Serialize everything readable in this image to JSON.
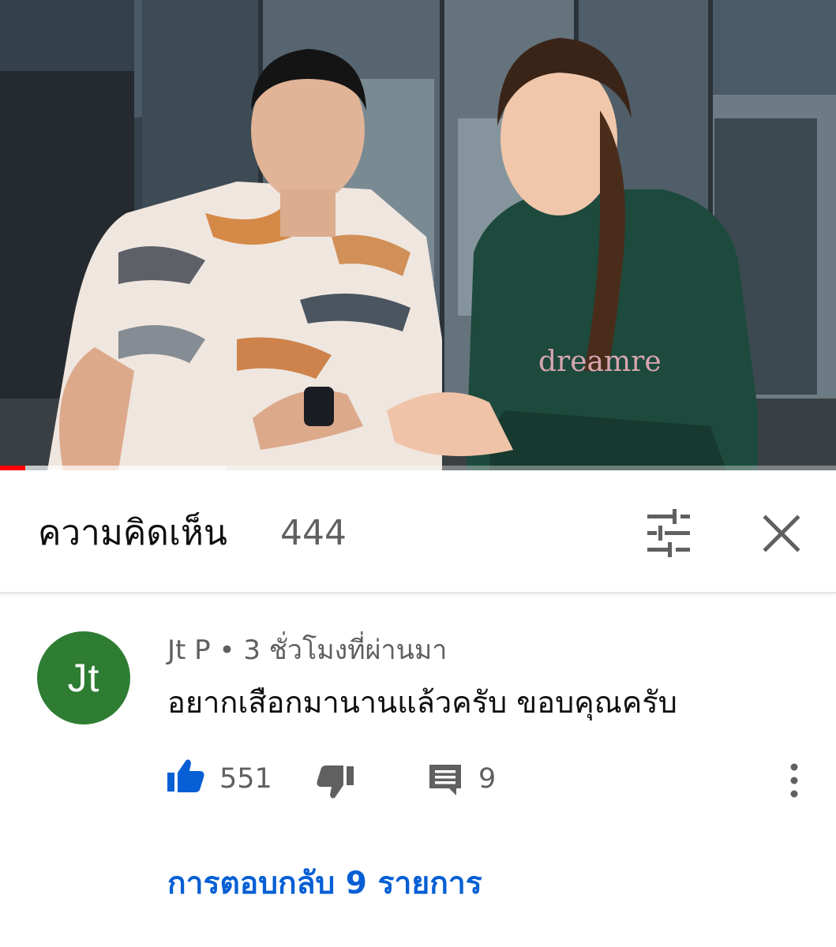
{
  "video": {
    "progress_fraction": 0.03,
    "buffered_fraction": 0.27,
    "shirt_print_text": "dreamre"
  },
  "comments_header": {
    "title": "ความคิดเห็น",
    "count": "444",
    "sort_icon": "sort-tune-icon",
    "close_icon": "close-icon"
  },
  "comment": {
    "avatar_initials": "Jt",
    "avatar_color": "#2e7d32",
    "meta": "Jt P • 3 ชั่วโมงที่ผ่านมา",
    "text": "อยากเสือกมานานแล้วครับ ขอบคุณครับ",
    "likes": "551",
    "replies": "9",
    "view_replies_label": "การตอบกลับ 9 รายการ"
  },
  "colors": {
    "like_active": "#065fd4",
    "link": "#065fd4",
    "secondary_text": "#606060",
    "progress": "#ff0000"
  }
}
